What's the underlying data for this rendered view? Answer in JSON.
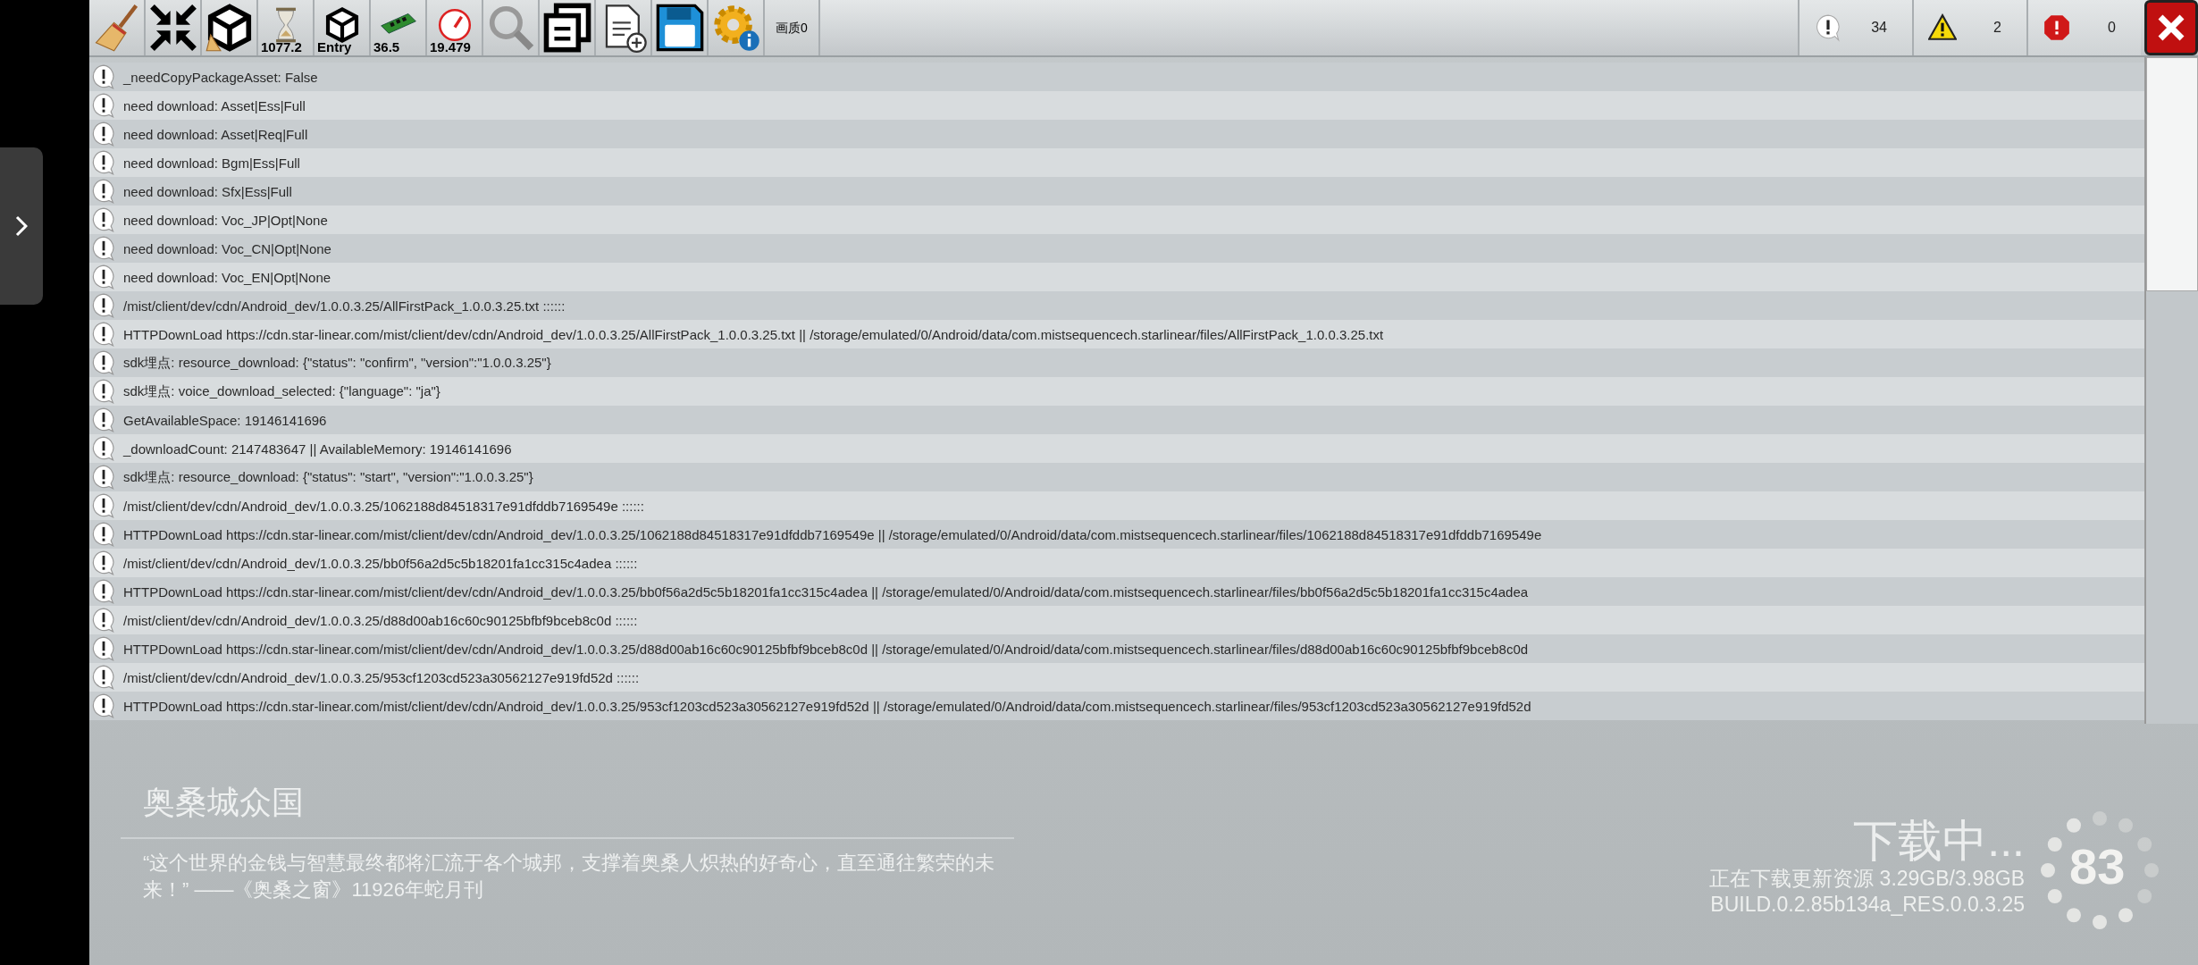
{
  "toolbar": {
    "tools": [
      {
        "kind": "broom"
      },
      {
        "kind": "collapse"
      },
      {
        "kind": "unity-broom"
      },
      {
        "kind": "hourglass",
        "label": "1077.2"
      },
      {
        "kind": "unity",
        "label": "Entry"
      },
      {
        "kind": "memory",
        "label": "36.5"
      },
      {
        "kind": "gauge",
        "label": "19.479"
      },
      {
        "kind": "search"
      },
      {
        "kind": "copy"
      },
      {
        "kind": "new-doc"
      },
      {
        "kind": "save"
      },
      {
        "kind": "settings-info"
      },
      {
        "kind": "text",
        "label": "画质0"
      }
    ],
    "counters": [
      {
        "kind": "info",
        "count": "34"
      },
      {
        "kind": "warning",
        "count": "2"
      },
      {
        "kind": "error",
        "count": "0"
      }
    ]
  },
  "log": {
    "rows": [
      "_needCopyPackageAsset: False",
      "need download: Asset|Ess|Full",
      "need download: Asset|Req|Full",
      "need download: Bgm|Ess|Full",
      "need download: Sfx|Ess|Full",
      "need download: Voc_JP|Opt|None",
      "need download: Voc_CN|Opt|None",
      "need download: Voc_EN|Opt|None",
      "/mist/client/dev/cdn/Android_dev/1.0.0.3.25/AllFirstPack_1.0.0.3.25.txt ::::::",
      "HTTPDownLoad https://cdn.star-linear.com/mist/client/dev/cdn/Android_dev/1.0.0.3.25/AllFirstPack_1.0.0.3.25.txt || /storage/emulated/0/Android/data/com.mistsequencech.starlinear/files/AllFirstPack_1.0.0.3.25.txt",
      "sdk埋点: resource_download: {\"status\": \"confirm\", \"version\":\"1.0.0.3.25\"}",
      "sdk埋点: voice_download_selected: {\"language\": \"ja\"}",
      "GetAvailableSpace: 19146141696",
      "_downloadCount: 2147483647 || AvailableMemory: 19146141696",
      "sdk埋点: resource_download: {\"status\": \"start\", \"version\":\"1.0.0.3.25\"}",
      "/mist/client/dev/cdn/Android_dev/1.0.0.3.25/1062188d84518317e91dfddb7169549e ::::::",
      "HTTPDownLoad https://cdn.star-linear.com/mist/client/dev/cdn/Android_dev/1.0.0.3.25/1062188d84518317e91dfddb7169549e || /storage/emulated/0/Android/data/com.mistsequencech.starlinear/files/1062188d84518317e91dfddb7169549e",
      "/mist/client/dev/cdn/Android_dev/1.0.0.3.25/bb0f56a2d5c5b18201fa1cc315c4adea ::::::",
      "HTTPDownLoad https://cdn.star-linear.com/mist/client/dev/cdn/Android_dev/1.0.0.3.25/bb0f56a2d5c5b18201fa1cc315c4adea || /storage/emulated/0/Android/data/com.mistsequencech.starlinear/files/bb0f56a2d5c5b18201fa1cc315c4adea",
      "/mist/client/dev/cdn/Android_dev/1.0.0.3.25/d88d00ab16c60c90125bfbf9bceb8c0d ::::::",
      "HTTPDownLoad https://cdn.star-linear.com/mist/client/dev/cdn/Android_dev/1.0.0.3.25/d88d00ab16c60c90125bfbf9bceb8c0d || /storage/emulated/0/Android/data/com.mistsequencech.starlinear/files/d88d00ab16c60c90125bfbf9bceb8c0d",
      "/mist/client/dev/cdn/Android_dev/1.0.0.3.25/953cf1203cd523a30562127e919fd52d ::::::",
      "HTTPDownLoad https://cdn.star-linear.com/mist/client/dev/cdn/Android_dev/1.0.0.3.25/953cf1203cd523a30562127e919fd52d || /storage/emulated/0/Android/data/com.mistsequencech.starlinear/files/953cf1203cd523a30562127e919fd52d"
    ]
  },
  "background": {
    "title": "奥桑城众国",
    "quote": "“这个世界的金钱与智慧最终都将汇流于各个城邦，支撑着奥桑人炽热的好奇心，直至通往繁荣的未来！” ——《奥桑之窗》11926年蛇月刊",
    "status": "下载中...",
    "progress_text": "正在下载更新资源 3.29GB/3.98GB",
    "build": "BUILD.0.2.85b134a_RES.0.0.3.25",
    "percent": "83"
  }
}
